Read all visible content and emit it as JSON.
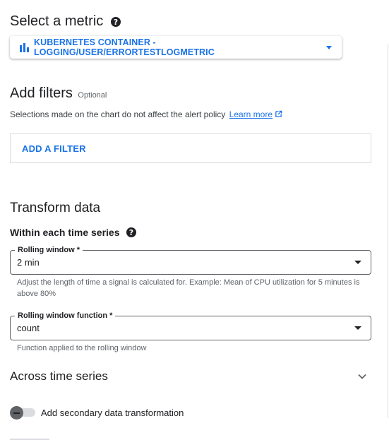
{
  "metric_section": {
    "title": "Select a metric",
    "help_icon": "help-icon",
    "metric_label": "KUBERNETES CONTAINER - LOGGING/USER/ERRORTESTLOGMETRIC",
    "metric_icon": "bar-chart-icon"
  },
  "filters_section": {
    "title": "Add filters",
    "optional": "Optional",
    "description": "Selections made on the chart do not affect the alert policy",
    "learn_more": "Learn more",
    "add_filter": "ADD A FILTER"
  },
  "transform": {
    "title": "Transform data",
    "within_title": "Within each time series",
    "rolling_window": {
      "label": "Rolling window *",
      "value": "2 min",
      "hint": "Adjust the length of time a signal is calculated for. Example: Mean of CPU utilization for 5 minutes is above 80%"
    },
    "rolling_function": {
      "label": "Rolling window function *",
      "value": "count",
      "hint": "Function applied to the rolling window"
    },
    "across_title": "Across time series",
    "secondary_label": "Add secondary data transformation"
  },
  "colors": {
    "accent": "#1a73e8",
    "text": "#202124",
    "muted": "#5f6368"
  }
}
